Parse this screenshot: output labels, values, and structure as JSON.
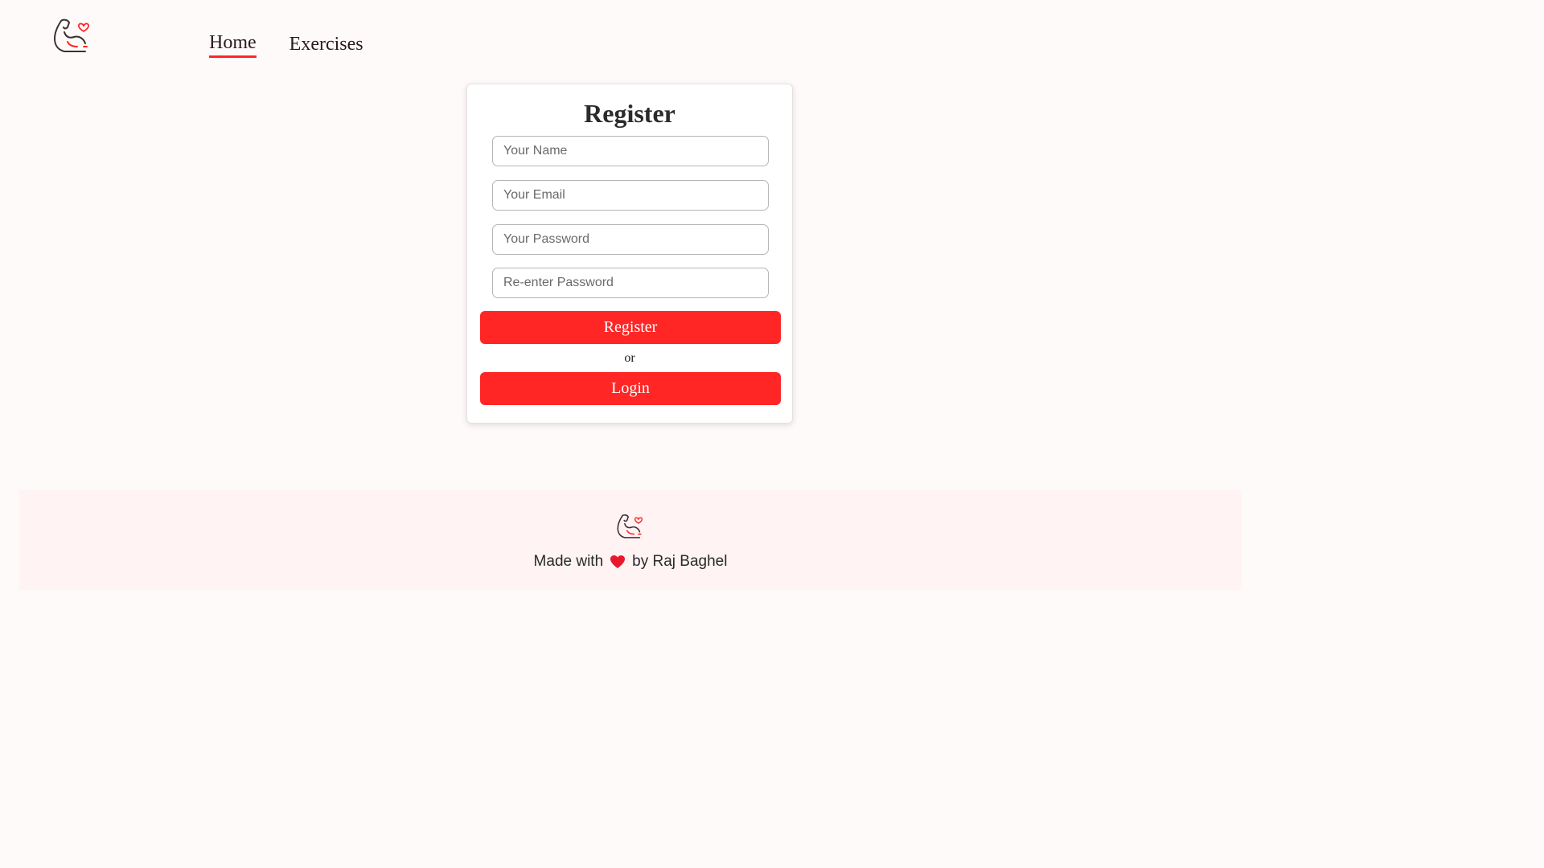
{
  "nav": {
    "items": [
      {
        "label": "Home",
        "active": true
      },
      {
        "label": "Exercises",
        "active": false
      }
    ]
  },
  "logo": {
    "icon": "flexed-arm-heart-icon"
  },
  "register": {
    "title": "Register",
    "name_placeholder": "Your Name",
    "email_placeholder": "Your Email",
    "password_placeholder": "Your Password",
    "reenter_placeholder": "Re-enter Password",
    "register_label": "Register",
    "or_text": "or",
    "login_label": "Login"
  },
  "footer": {
    "made_with": "Made with",
    "by_text": "by Raj Baghel",
    "heart_icon": "heart-icon"
  },
  "colors": {
    "accent": "#ff2625",
    "background": "#fffafa",
    "footer_bg": "#fff3f3"
  }
}
